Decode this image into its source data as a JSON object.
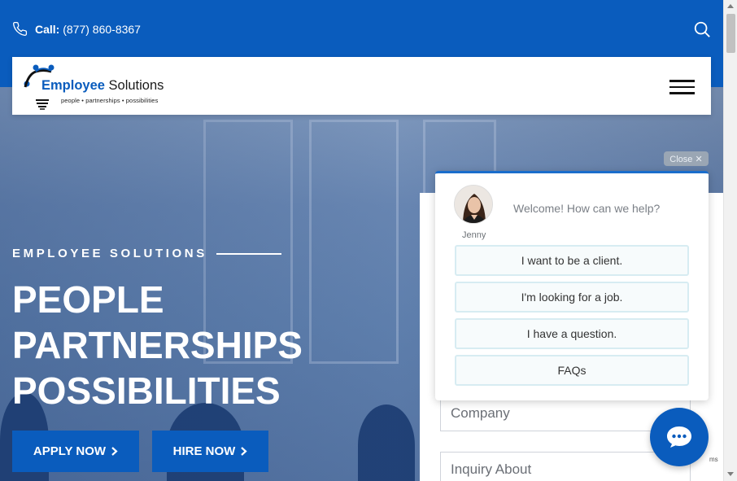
{
  "topbar": {
    "call_label": "Call:",
    "phone": "(877) 860-8367"
  },
  "header": {
    "logo_word1": "Employee",
    "logo_word2": " Solutions",
    "logo_tagline": "people • partnerships • possibilities"
  },
  "hero": {
    "eyebrow": "EMPLOYEE SOLUTIONS",
    "headline": [
      "PEOPLE",
      "PARTNERSHIPS",
      "POSSIBILITIES"
    ],
    "apply_label": "APPLY NOW",
    "hire_label": "HIRE NOW"
  },
  "form": {
    "company_placeholder": "Company",
    "inquiry_placeholder": "Inquiry About"
  },
  "chat": {
    "close_label": "Close ✕",
    "agent_name": "Jenny",
    "welcome": "Welcome! How can we help?",
    "options": [
      "I want to be a client.",
      "I'm looking for a job.",
      "I have a question.",
      "FAQs"
    ]
  },
  "misc": {
    "recaptcha_text": "ms"
  },
  "colors": {
    "brand_blue": "#0a5cbd",
    "option_border": "#d7ecf2"
  },
  "icons": {
    "phone": "phone-icon",
    "search": "search-icon",
    "menu": "hamburger-menu-icon",
    "chevron": "chevron-right-icon",
    "chat": "chat-bubble-icon"
  }
}
